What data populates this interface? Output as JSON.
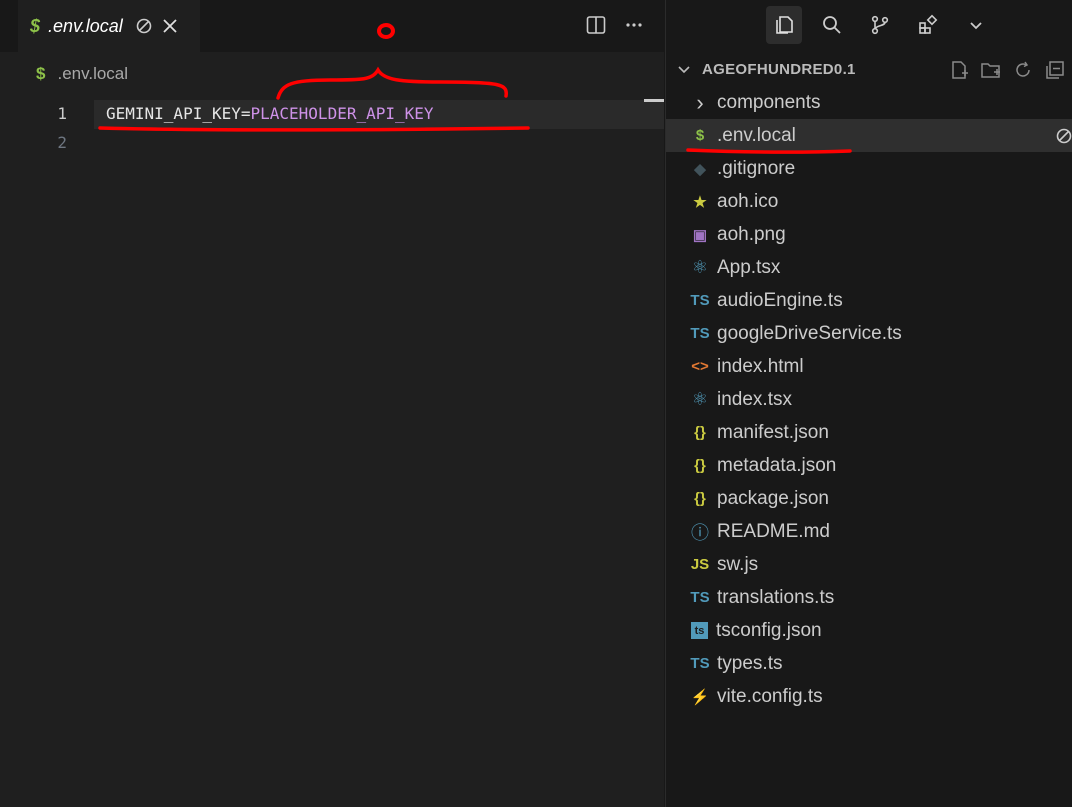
{
  "editor": {
    "tab": {
      "label": ".env.local",
      "icon": "dollar-icon"
    },
    "breadcrumb": {
      "label": ".env.local"
    },
    "lines": [
      {
        "number": "1",
        "key": "GEMINI_API_KEY=",
        "value": "PLACEHOLDER_API_KEY"
      },
      {
        "number": "2",
        "key": "",
        "value": ""
      }
    ],
    "dollar_glyph": "$"
  },
  "explorer": {
    "section_title": "AGEOFHUNDRED0.1",
    "items": [
      {
        "label": "components",
        "icon": "chevron-right-icon",
        "glyph": "›",
        "color": "#cccccc"
      },
      {
        "label": ".env.local",
        "icon": "dollar-icon",
        "glyph": "$",
        "color": "#8dc149",
        "selected": true
      },
      {
        "label": ".gitignore",
        "icon": "git-icon",
        "glyph": "◆",
        "color": "#41535b"
      },
      {
        "label": "aoh.ico",
        "icon": "star-icon",
        "glyph": "★",
        "color": "#cbcb41"
      },
      {
        "label": "aoh.png",
        "icon": "image-icon",
        "glyph": "▣",
        "color": "#a074c4"
      },
      {
        "label": "App.tsx",
        "icon": "react-icon",
        "glyph": "⚛",
        "color": "#519aba"
      },
      {
        "label": "audioEngine.ts",
        "icon": "typescript-icon",
        "glyph": "TS",
        "color": "#519aba"
      },
      {
        "label": "googleDriveService.ts",
        "icon": "typescript-icon",
        "glyph": "TS",
        "color": "#519aba"
      },
      {
        "label": "index.html",
        "icon": "html-icon",
        "glyph": "<>",
        "color": "#e37933"
      },
      {
        "label": "index.tsx",
        "icon": "react-icon",
        "glyph": "⚛",
        "color": "#519aba"
      },
      {
        "label": "manifest.json",
        "icon": "json-icon",
        "glyph": "{}",
        "color": "#cbcb41"
      },
      {
        "label": "metadata.json",
        "icon": "json-icon",
        "glyph": "{}",
        "color": "#cbcb41"
      },
      {
        "label": "package.json",
        "icon": "json-icon",
        "glyph": "{}",
        "color": "#cbcb41"
      },
      {
        "label": "README.md",
        "icon": "info-icon",
        "glyph": "ⓘ",
        "color": "#519aba"
      },
      {
        "label": "sw.js",
        "icon": "javascript-icon",
        "glyph": "JS",
        "color": "#cbcb41"
      },
      {
        "label": "translations.ts",
        "icon": "typescript-icon",
        "glyph": "TS",
        "color": "#519aba"
      },
      {
        "label": "tsconfig.json",
        "icon": "tsconfig-icon",
        "glyph": "ts",
        "color": "#519aba"
      },
      {
        "label": "types.ts",
        "icon": "typescript-icon",
        "glyph": "TS",
        "color": "#519aba"
      },
      {
        "label": "vite.config.ts",
        "icon": "vite-icon",
        "glyph": "⚡",
        "color": "#cbcb41"
      }
    ]
  },
  "colors": {
    "annotation": "#ff0000",
    "accent_green": "#8dc149",
    "string_value": "#ce92e8"
  }
}
